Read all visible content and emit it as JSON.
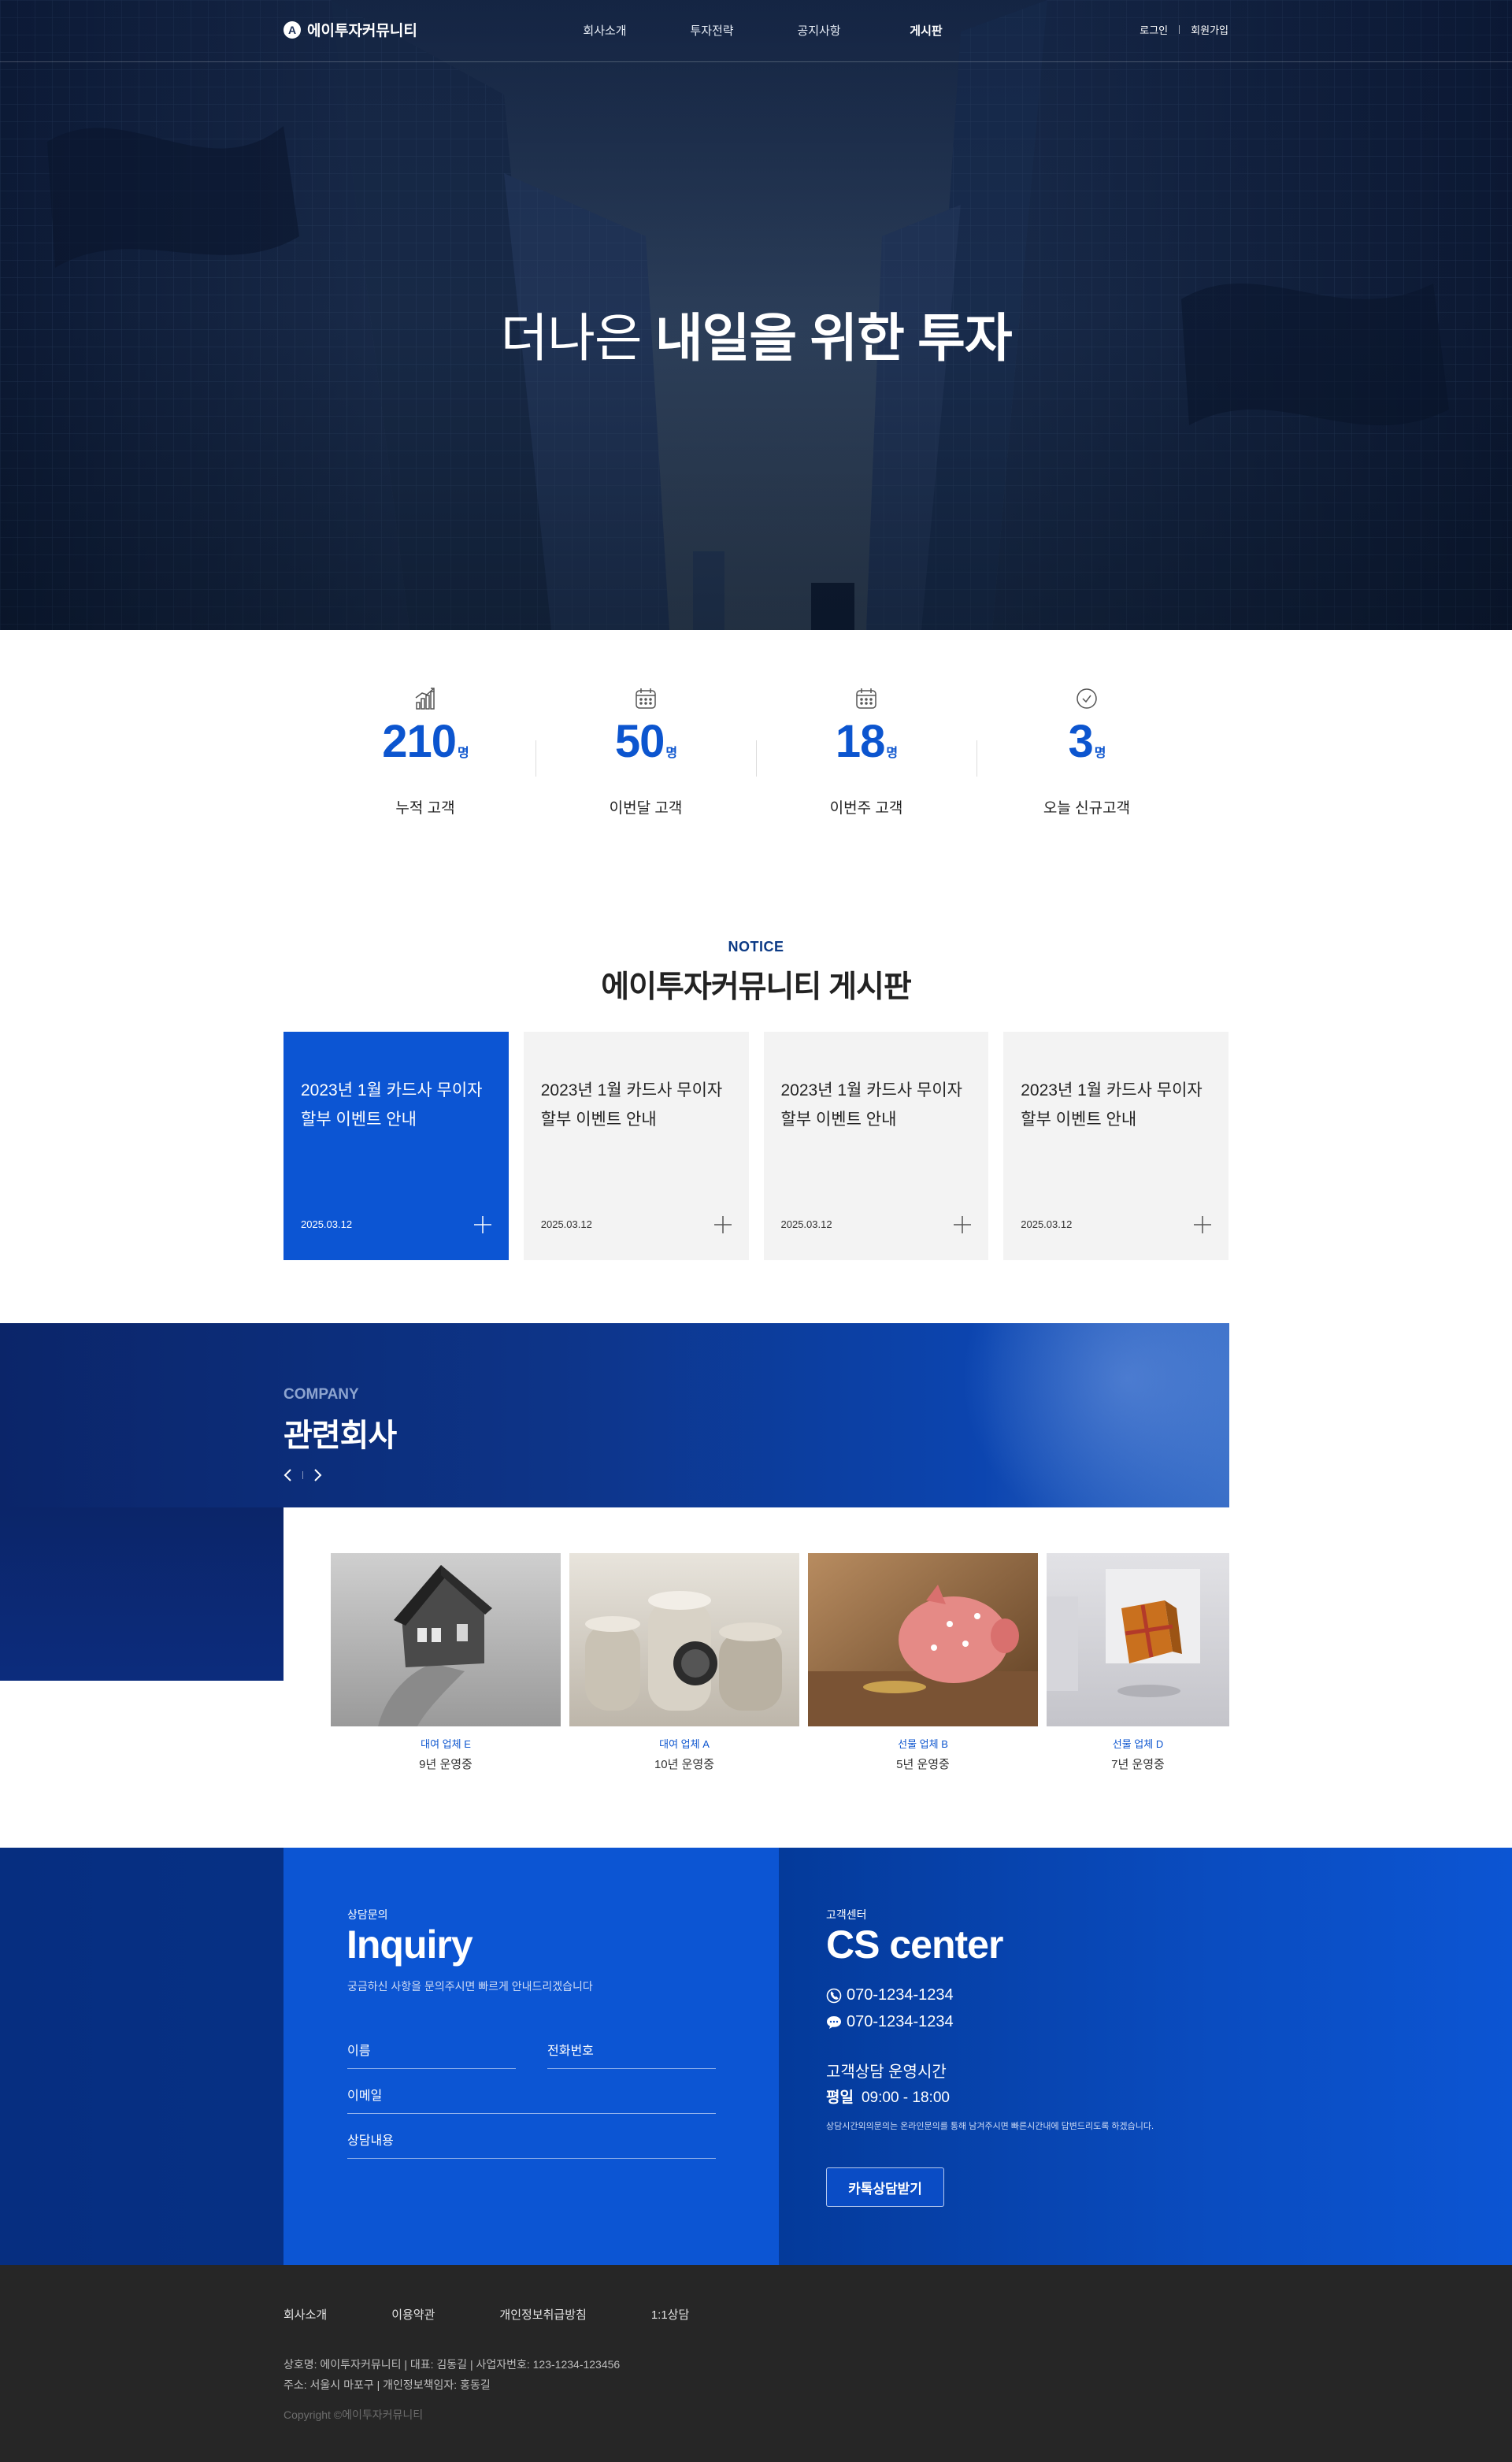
{
  "header": {
    "logo_mark": "A",
    "logo_text": "에이투자커뮤니티",
    "nav": [
      "회사소개",
      "투자전략",
      "공지사항",
      "게시판"
    ],
    "active_nav": "게시판",
    "util": {
      "login": "로그인",
      "join": "회원가입"
    }
  },
  "hero": {
    "title_light": "더나은",
    "title_bold": "내일을 위한 투자"
  },
  "stats": [
    {
      "icon": "bar-chart-icon",
      "value": "210",
      "unit": "명",
      "label": "누적 고객"
    },
    {
      "icon": "calendar-icon",
      "value": "50",
      "unit": "명",
      "label": "이번달 고객"
    },
    {
      "icon": "calendar-icon",
      "value": "18",
      "unit": "명",
      "label": "이번주 고객"
    },
    {
      "icon": "clock-icon",
      "value": "3",
      "unit": "명",
      "label": "오늘 신규고객"
    }
  ],
  "notice": {
    "eyebrow": "NOTICE",
    "title_light": "에이투자커뮤니티",
    "title_bold": "게시판",
    "cards": [
      {
        "line1": "2023년 1월 카드사 무이자",
        "line2": "할부 이벤트 안내",
        "date": "2025.03.12"
      },
      {
        "line1": "2023년 1월 카드사 무이자",
        "line2": "할부 이벤트 안내",
        "date": "2025.03.12"
      },
      {
        "line1": "2023년 1월 카드사 무이자",
        "line2": "할부 이벤트 안내",
        "date": "2025.03.12"
      },
      {
        "line1": "2023년 1월 카드사 무이자",
        "line2": "할부 이벤트 안내",
        "date": "2025.03.12"
      }
    ]
  },
  "company": {
    "eyebrow": "COMPANY",
    "title": "관련회사",
    "partners": [
      {
        "type": "대여 업체 E",
        "years": "9년 운영중"
      },
      {
        "type": "대여 업체 A",
        "years": "10년 운영중"
      },
      {
        "type": "선물 업체 B",
        "years": "5년 운영중"
      },
      {
        "type": "선물 업체 D",
        "years": "7년 운영중"
      }
    ]
  },
  "inquiry": {
    "eyebrow": "상담문의",
    "title": "Inquiry",
    "desc": "궁금하신 사항을 문의주시면 빠르게 안내드리겠습니다",
    "fields": {
      "name": "이름",
      "phone": "전화번호",
      "email": "이메일",
      "content": "상담내용"
    }
  },
  "cs": {
    "eyebrow": "고객센터",
    "title": "CS center",
    "phone": "070-1234-1234",
    "chat": "070-1234-1234",
    "hours_title": "고객상담 운영시간",
    "hours_day": "평일",
    "hours_time": "09:00 - 18:00",
    "note": "상담시간외의문의는 온라인문의를 통해 남겨주시면 빠른시간내에 답변드리도록 하겠습니다.",
    "button": "카톡상담받기"
  },
  "footer": {
    "nav": [
      "회사소개",
      "이용약관",
      "개인정보취급방침",
      "1:1상담"
    ],
    "info1": "상호명: 에이투자커뮤니티 | 대표: 김동길 | 사업자번호: 123-1234-123456",
    "info2": "주소: 서울시 마포구 | 개인정보책임자: 홍동길",
    "copyright": "Copyright ©에이투자커뮤니티"
  },
  "colors": {
    "accent": "#0c55d3",
    "navy": "#0b2569",
    "footer": "#262626"
  }
}
